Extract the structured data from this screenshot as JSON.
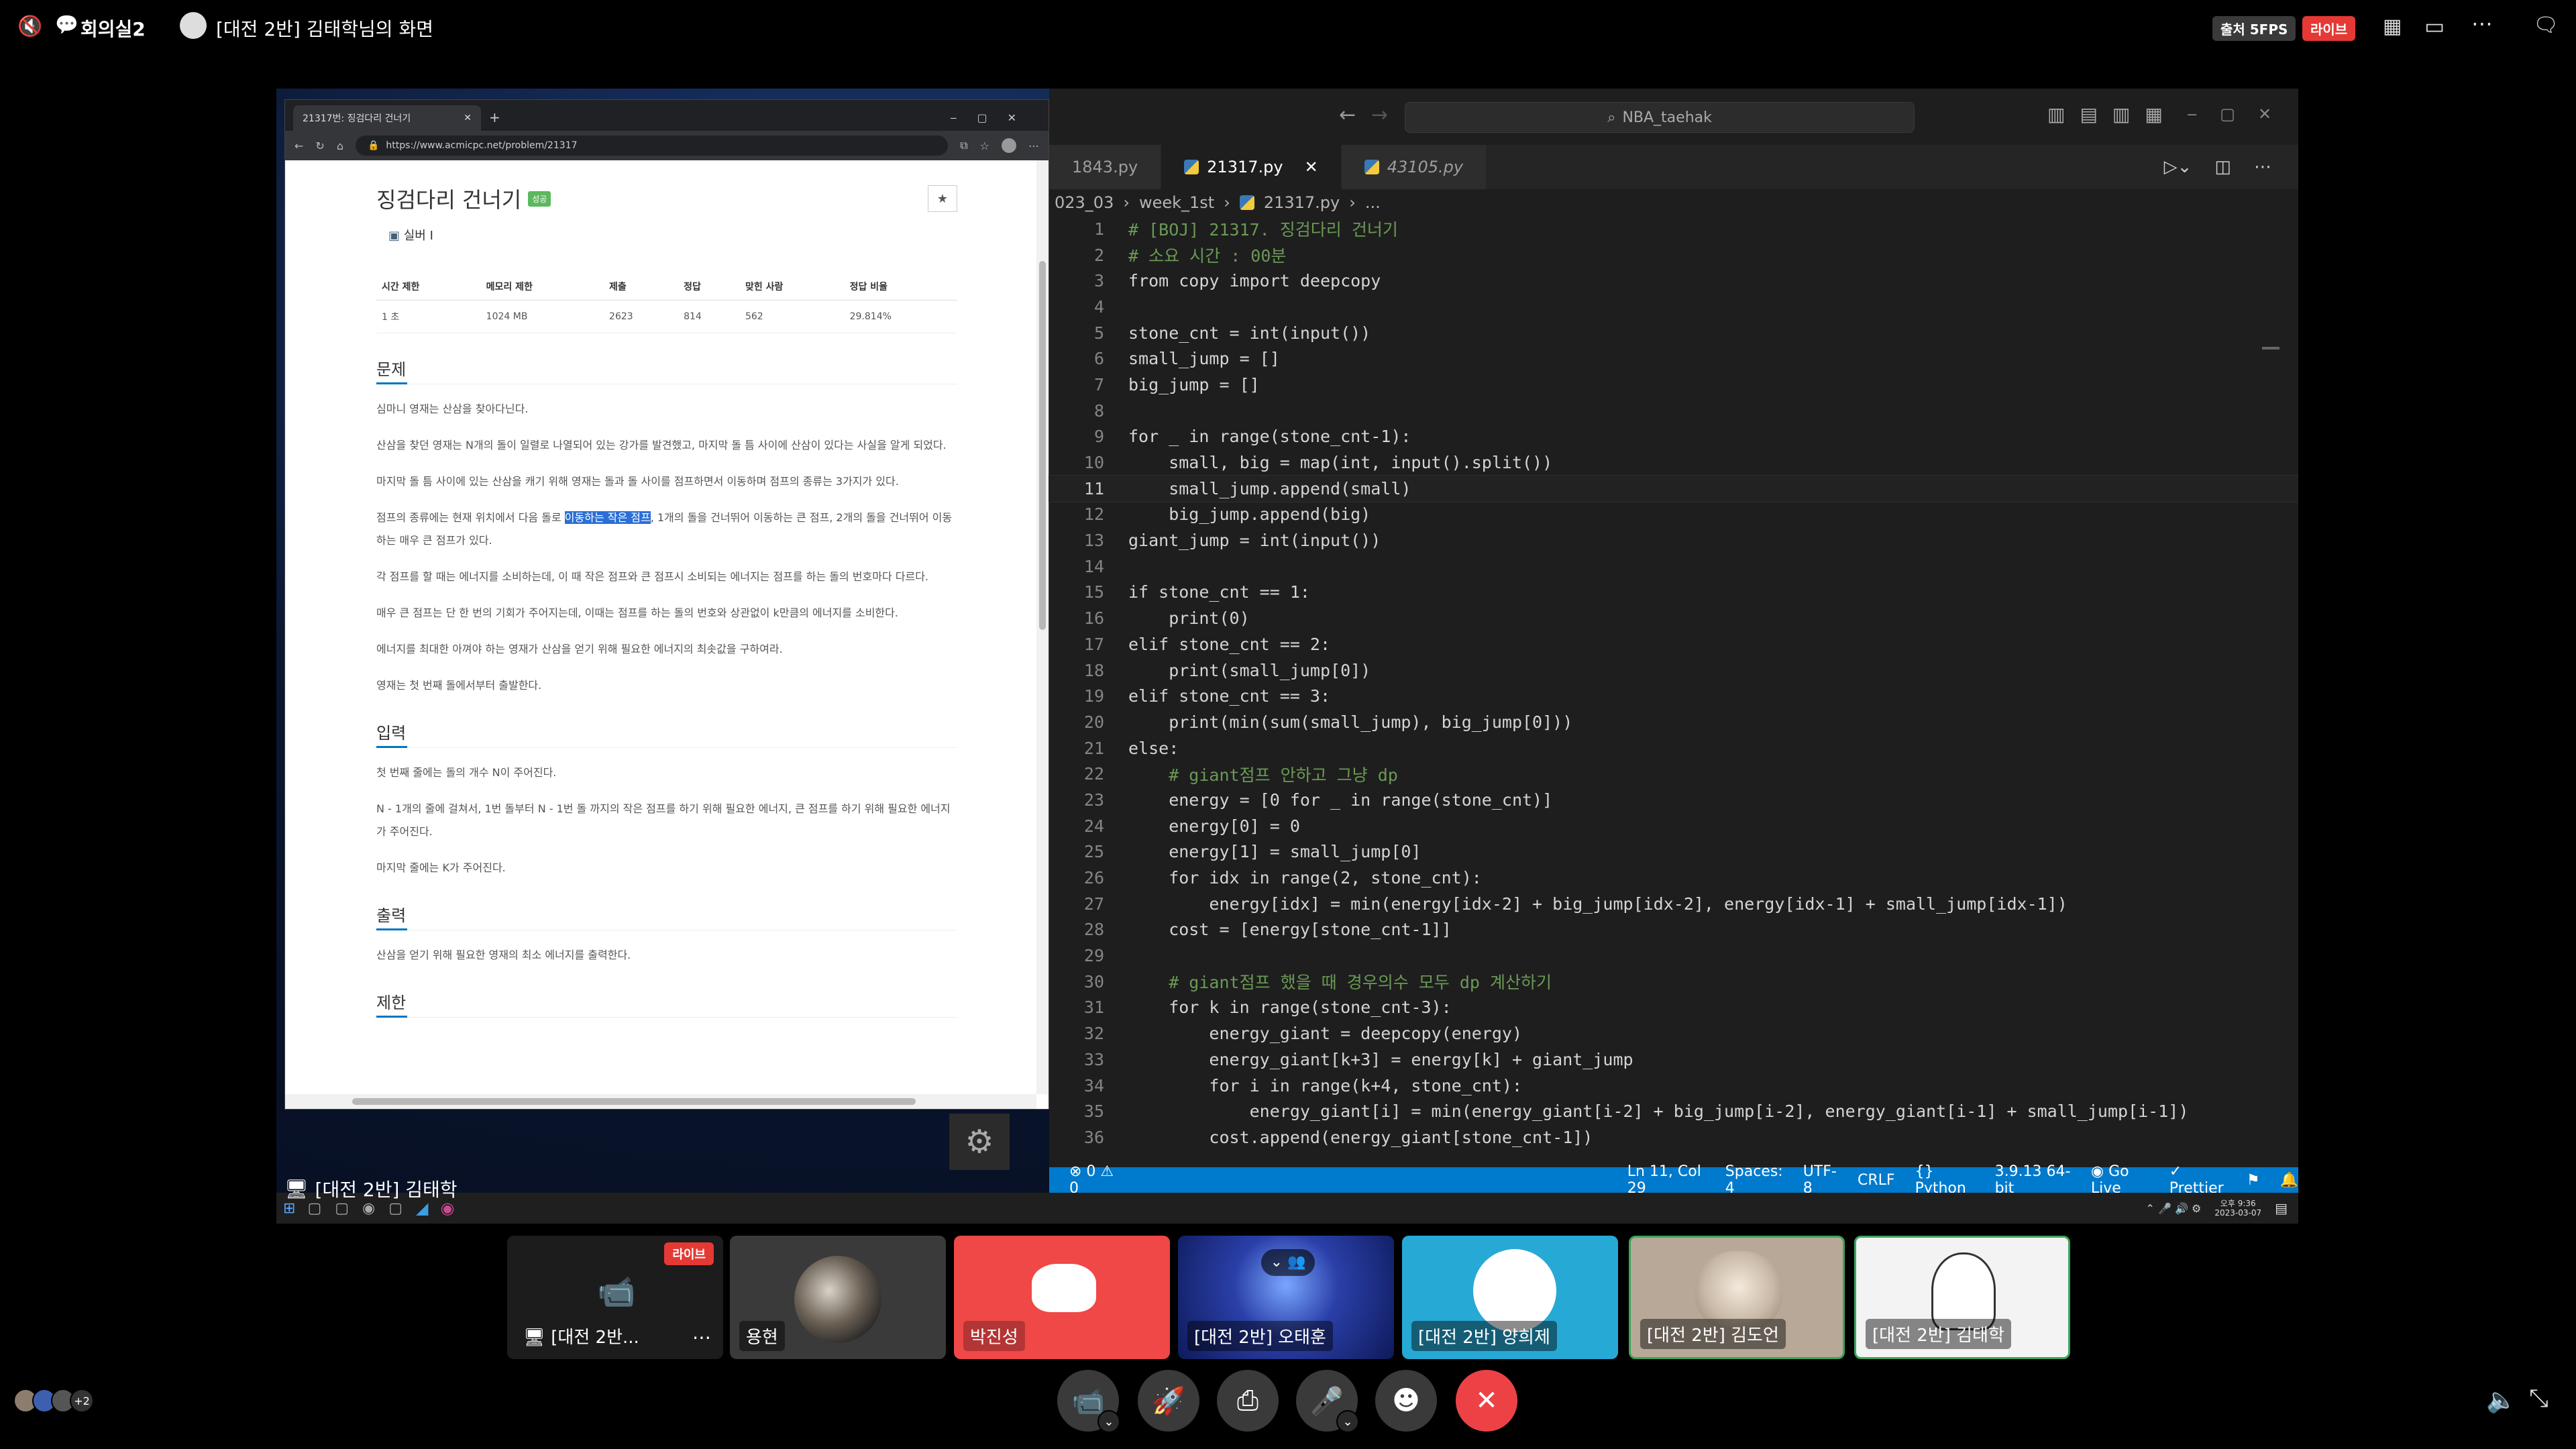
{
  "topbar": {
    "channel": "회의실2",
    "screen_title": "[대전 2반] 김태학님의 화면",
    "quality": "출처 5FPS",
    "live": "라이브"
  },
  "browser": {
    "tab_title": "21317번: 징검다리 건너기",
    "url": "https://www.acmicpc.net/problem/21317",
    "problem": {
      "title": "징검다리 건너기",
      "badge": "성공",
      "tier": "실버 I",
      "table_headers": [
        "시간 제한",
        "메모리 제한",
        "제출",
        "정답",
        "맞힌 사람",
        "정답 비율"
      ],
      "table_values": [
        "1 초",
        "1024 MB",
        "2623",
        "814",
        "562",
        "29.814%"
      ],
      "section_problem": "문제",
      "p1": "심마니 영재는 산삼을 찾아다닌다.",
      "p2": "산삼을 찾던 영재는 N개의 돌이 일렬로 나열되어 있는 강가를 발견했고, 마지막 돌 틈 사이에 산삼이 있다는 사실을 알게 되었다.",
      "p3": "마지막 돌 틈 사이에 있는 산삼을 캐기 위해 영재는 돌과 돌 사이를 점프하면서 이동하며 점프의 종류는 3가지가 있다.",
      "p4a": "점프의 종류에는 현재 위치에서 다음 돌로 ",
      "p4hl": "이동하는 작은 점프",
      "p4b": ", 1개의 돌을 건너뛰어 이동하는 큰 점프, 2개의 돌을 건너뛰어 이동하는 매우 큰 점프가 있다.",
      "p5": "각 점프를 할 때는 에너지를 소비하는데, 이 때 작은 점프와 큰 점프시 소비되는 에너지는 점프를 하는 돌의 번호마다 다르다.",
      "p6": "매우 큰 점프는 단 한 번의 기회가 주어지는데, 이때는 점프를 하는 돌의 번호와 상관없이 k만큼의 에너지를 소비한다.",
      "p7": "에너지를 최대한 아껴야 하는 영재가 산삼을 얻기 위해 필요한 에너지의 최솟값을 구하여라.",
      "p8": "영재는 첫 번째 돌에서부터 출발한다.",
      "section_input": "입력",
      "i1": "첫 번째 줄에는 돌의 개수 N이 주어진다.",
      "i2": "N - 1개의 줄에 걸쳐서, 1번 돌부터 N - 1번 돌 까지의 작은 점프를 하기 위해 필요한 에너지, 큰 점프를 하기 위해 필요한 에너지가 주어진다.",
      "i3": "마지막 줄에는 K가 주어진다.",
      "section_output": "출력",
      "o1": "산삼을 얻기 위해 필요한 영재의 최소 에너지를 출력한다.",
      "section_limit": "제한"
    }
  },
  "vscode": {
    "search": "NBA_taehak",
    "tabs": [
      "1843.py",
      "21317.py",
      "43105.py"
    ],
    "breadcrumb": [
      "023_03",
      "week_1st",
      "21317.py",
      "..."
    ],
    "lines": [
      "# [BOJ] 21317. 징검다리 건너기",
      "# 소요 시간 : 00분",
      "from copy import deepcopy",
      "",
      "stone_cnt = int(input())",
      "small_jump = []",
      "big_jump = []",
      "",
      "for _ in range(stone_cnt-1):",
      "    small, big = map(int, input().split())",
      "    small_jump.append(small)",
      "    big_jump.append(big)",
      "giant_jump = int(input())",
      "",
      "if stone_cnt == 1:",
      "    print(0)",
      "elif stone_cnt == 2:",
      "    print(small_jump[0])",
      "elif stone_cnt == 3:",
      "    print(min(sum(small_jump), big_jump[0]))",
      "else:",
      "    # giant점프 안하고 그냥 dp",
      "    energy = [0 for _ in range(stone_cnt)]",
      "    energy[0] = 0",
      "    energy[1] = small_jump[0]",
      "    for idx in range(2, stone_cnt):",
      "        energy[idx] = min(energy[idx-2] + big_jump[idx-2], energy[idx-1] + small_jump[idx-1])",
      "    cost = [energy[stone_cnt-1]]",
      "",
      "    # giant점프 했을 때 경우의수 모두 dp 계산하기",
      "    for k in range(stone_cnt-3):",
      "        energy_giant = deepcopy(energy)",
      "        energy_giant[k+3] = energy[k] + giant_jump",
      "        for i in range(k+4, stone_cnt):",
      "            energy_giant[i] = min(energy_giant[i-2] + big_jump[i-2], energy_giant[i-1] + small_jump[i-1])",
      "        cost.append(energy_giant[stone_cnt-1])"
    ],
    "status": {
      "problems": "⊗ 0 ⚠ 0",
      "position": "Ln 11, Col 29",
      "spaces": "Spaces: 4",
      "encoding": "UTF-8",
      "eol": "CRLF",
      "language": "Python",
      "interpreter": "3.9.13 64-bit",
      "golive": "Go Live",
      "prettier": "Prettier"
    }
  },
  "taskbar": {
    "sharer_label": "[대전 2반] 김태학",
    "time": "오후 9:36",
    "date": "2023-03-07"
  },
  "tiles": [
    {
      "name": "[대전 2반...",
      "live": "라이브"
    },
    {
      "name": "용현"
    },
    {
      "name": "박진성"
    },
    {
      "name": "[대전 2반] 오태훈"
    },
    {
      "name": "[대전 2반] 양희제"
    },
    {
      "name": "[대전 2반] 김도언"
    },
    {
      "name": "[대전 2반] 김태학"
    }
  ],
  "avatars_more": "+2",
  "colors": {
    "accent_blue": "#007acc",
    "discord": "#f04747",
    "live_red": "#e53935",
    "speaking_green": "#3ba55c"
  }
}
